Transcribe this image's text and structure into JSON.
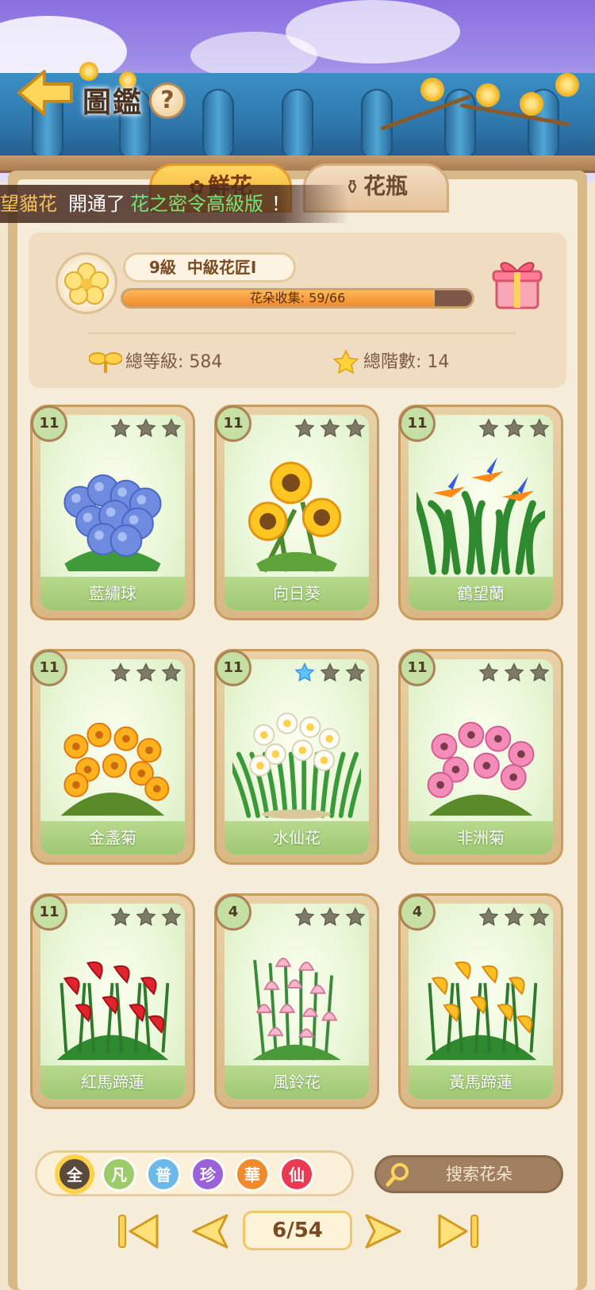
{
  "header": {
    "title": "圖鑑",
    "help_symbol": "?"
  },
  "tabs": [
    {
      "label": "鮮花",
      "active": true
    },
    {
      "label": "花瓶",
      "active": false
    }
  ],
  "marquee": {
    "name": "望貓花",
    "text": "開通了",
    "highlight": "花之密令高級版",
    "end": "！"
  },
  "stats": {
    "level_num": "9級",
    "level_title": "中級花匠I",
    "progress_text": "花朵收集: 59/66",
    "progress_fraction": 0.894,
    "total_level": "總等級: 584",
    "total_stars": "總階數: 14"
  },
  "cards": [
    {
      "name": "藍繡球",
      "level": "11",
      "stars": [
        "gray",
        "gray",
        "gray"
      ],
      "plant": "hydrangea"
    },
    {
      "name": "向日葵",
      "level": "11",
      "stars": [
        "gray",
        "gray",
        "gray"
      ],
      "plant": "sunflower"
    },
    {
      "name": "鶴望蘭",
      "level": "11",
      "stars": [
        "gray",
        "gray",
        "gray"
      ],
      "plant": "strelitzia"
    },
    {
      "name": "金盞菊",
      "level": "11",
      "stars": [
        "gray",
        "gray",
        "gray"
      ],
      "plant": "calendula"
    },
    {
      "name": "水仙花",
      "level": "11",
      "stars": [
        "blue",
        "gray",
        "gray"
      ],
      "plant": "narcissus"
    },
    {
      "name": "非洲菊",
      "level": "11",
      "stars": [
        "gray",
        "gray",
        "gray"
      ],
      "plant": "gerbera"
    },
    {
      "name": "紅馬蹄蓮",
      "level": "11",
      "stars": [
        "gray",
        "gray",
        "gray"
      ],
      "plant": "red-calla"
    },
    {
      "name": "風鈴花",
      "level": "4",
      "stars": [
        "gray",
        "gray",
        "gray"
      ],
      "plant": "bellflower"
    },
    {
      "name": "黃馬蹄蓮",
      "level": "4",
      "stars": [
        "gray",
        "gray",
        "gray"
      ],
      "plant": "yellow-calla"
    }
  ],
  "filters": [
    {
      "label": "全",
      "color": "#5a4a3c",
      "selected": true
    },
    {
      "label": "凡",
      "color": "#9ccc6a",
      "selected": false
    },
    {
      "label": "普",
      "color": "#6cb8e8",
      "selected": false
    },
    {
      "label": "珍",
      "color": "#9a62d8",
      "selected": false
    },
    {
      "label": "華",
      "color": "#f08a2a",
      "selected": false
    },
    {
      "label": "仙",
      "color": "#e83a52",
      "selected": false
    }
  ],
  "search": {
    "placeholder": "搜索花朵"
  },
  "pagination": {
    "label": "6/54"
  }
}
